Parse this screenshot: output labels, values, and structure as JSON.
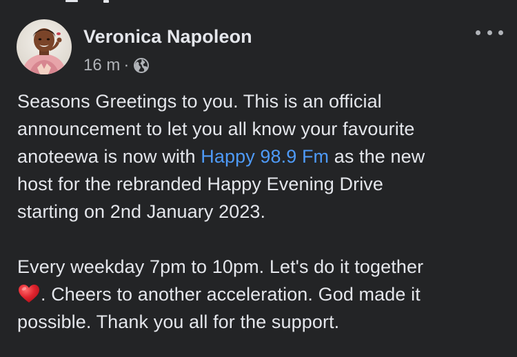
{
  "post": {
    "author_name": "Veronica Napoleon",
    "timestamp": "16 m",
    "separator": "·",
    "privacy_icon": "globe-icon",
    "more_icon": "more-options-icon",
    "body": {
      "p1_l1": "Seasons Greetings to you. This is an official",
      "p1_l2": "announcement to let you all know your favourite",
      "p1_l3_before": "anoteewa is now with ",
      "p1_l3_link": "Happy 98.9 Fm",
      "p1_l3_after": " as the new",
      "p1_l4": "host for the rebranded Happy Evening Drive",
      "p1_l5": "starting on 2nd January 2023.",
      "p2_l1": "Every weekday 7pm to 10pm. Let's do it together",
      "p2_l2_emoji": "heart-emoji",
      "p2_l2_text": ".  Cheers to another acceleration. God made it",
      "p2_l3": "possible. Thank you all for the support."
    }
  },
  "colors": {
    "background": "#232426",
    "text_primary": "#e4e6eb",
    "text_secondary": "#b0b3b8",
    "link": "#4e9af7",
    "heart": "#e0242e"
  }
}
